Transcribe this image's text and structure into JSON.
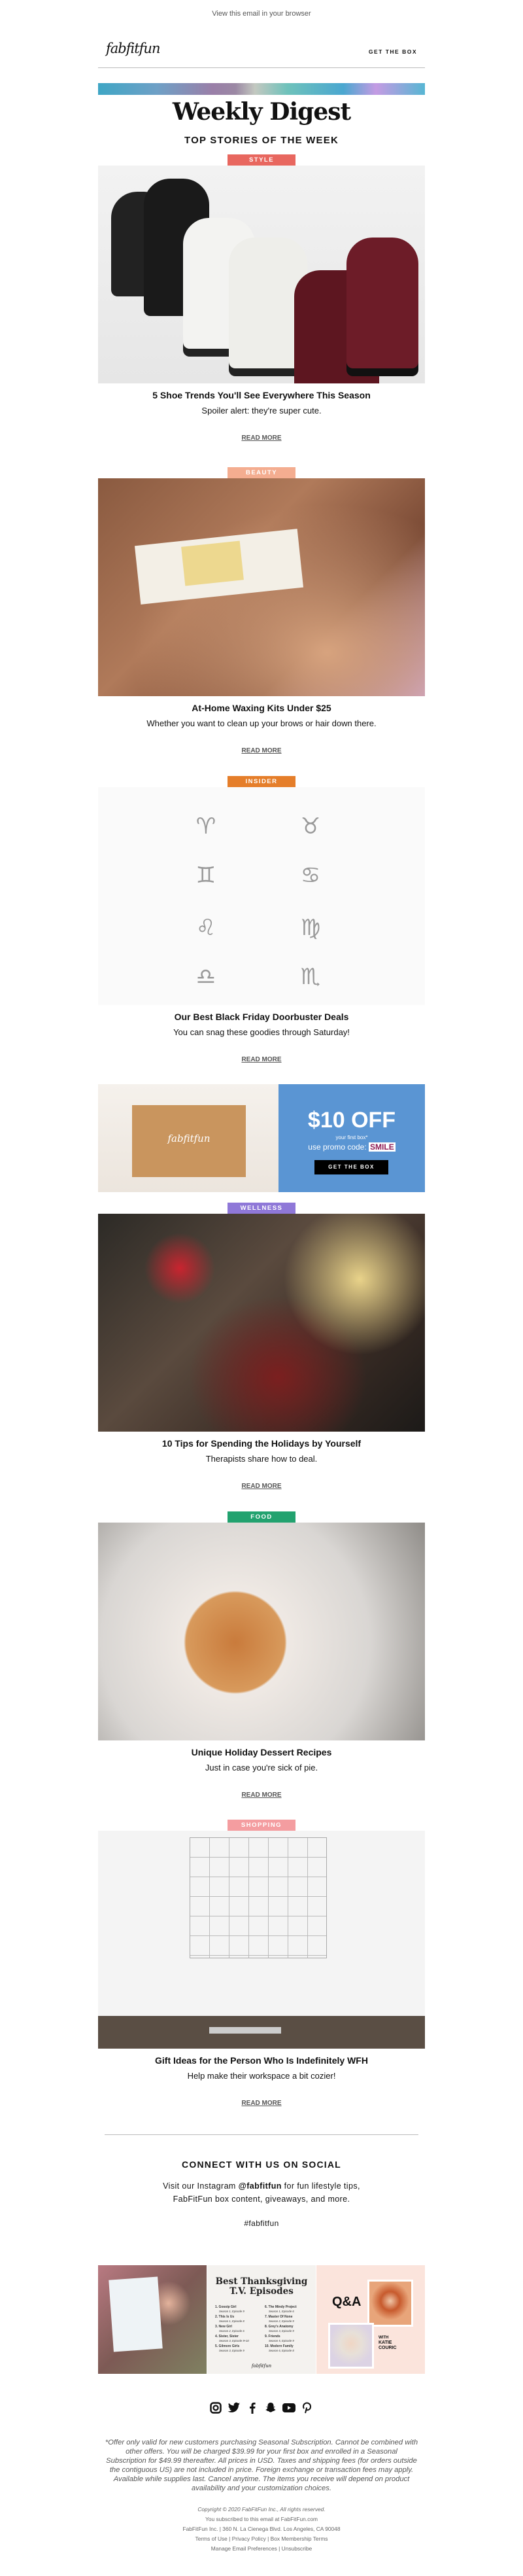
{
  "header": {
    "view_in_browser": "View this email in your browser",
    "logo": "fabfitfun",
    "get_the_box": "GET THE BOX"
  },
  "hero": {
    "title": "Weekly Digest",
    "subtitle": "TOP STORIES OF THE WEEK"
  },
  "articles": [
    {
      "tag": "STYLE",
      "tag_color": "#e8675f",
      "title": "5 Shoe Trends You'll See Everywhere This Season",
      "subtitle": "Spoiler alert: they're super cute.",
      "read_more": "READ MORE"
    },
    {
      "tag": "BEAUTY",
      "tag_color": "#f4ad90",
      "title": "At-Home Waxing Kits Under $25",
      "subtitle": "Whether you want to clean up your brows or hair down there.",
      "read_more": "READ MORE"
    },
    {
      "tag": "INSIDER",
      "tag_color": "#e57e2a",
      "title": "Our Best Black Friday Doorbuster Deals",
      "subtitle": "You can snag these goodies through Saturday!",
      "read_more": "READ MORE"
    },
    {
      "tag": "WELLNESS",
      "tag_color": "#8f78d8",
      "title": "10 Tips for Spending the Holidays by Yourself",
      "subtitle": "Therapists share how to deal.",
      "read_more": "READ MORE"
    },
    {
      "tag": "FOOD",
      "tag_color": "#22a26f",
      "title": "Unique Holiday Dessert Recipes",
      "subtitle": "Just in case you're sick of pie.",
      "read_more": "READ MORE"
    },
    {
      "tag": "SHOPPING",
      "tag_color": "#f49da0",
      "title": "Gift Ideas for the Person Who Is Indefinitely WFH",
      "subtitle": "Help make their workspace a bit cozier!",
      "read_more": "READ MORE"
    }
  ],
  "promo": {
    "box_logo": "fabfitfun",
    "headline": "$10 OFF",
    "subline": "your first box*",
    "code_prefix": "use promo code:",
    "code": "SMILE",
    "button": "GET THE BOX",
    "bg_color": "#5a95d3"
  },
  "social": {
    "heading": "CONNECT WITH US ON SOCIAL",
    "line1_pre": "Visit our Instagram ",
    "handle": "@fabfitfun",
    "line1_post": " for fun lifestyle tips,",
    "line2": "FabFitFun box content, giveaways, and more.",
    "hashtag": "#fabfitfun",
    "icons": [
      "instagram-icon",
      "twitter-icon",
      "facebook-icon",
      "snapchat-icon",
      "youtube-icon",
      "pinterest-icon"
    ]
  },
  "instagram_tiles": {
    "tile2": {
      "title": "Best Thanksgiving T.V. Episodes",
      "episodes_left": [
        "1. Gossip Girl",
        "Season 1, Episode 9",
        "2. This Is Us",
        "Season 1, Episode 8",
        "3. New Girl",
        "Season 2, Episode 6",
        "4. Sister, Sister",
        "Season 3, Episode 9+10",
        "5. Gilmore Girls",
        "Season 3, Episode 9"
      ],
      "episodes_right": [
        "6. The Mindy Project",
        "Season 1, Episode 6",
        "7. Master Of None",
        "Season 2, Episode 9",
        "8. Grey's Anatomy",
        "Season 3, Episode 9",
        "9. Friends",
        "Season 5, Episode 9",
        "10. Modern Family",
        "Season 6, Episode 8"
      ],
      "logo": "fabfitfun"
    },
    "tile3": {
      "qa": "Q&A",
      "with": "WITH",
      "name_first": "KATIE",
      "name_last": "COURIC"
    }
  },
  "footer": {
    "disclaimer": "*Offer only valid for new customers purchasing Seasonal Subscription. Cannot be combined with other offers. You will be charged $39.99 for your first box and enrolled in a Seasonal Subscription for $49.99 thereafter. All prices in USD. Taxes and shipping fees (for orders outside the contiguous US) are not included in price. Foreign exchange or transaction fees may apply. Available while supplies last. Cancel anytime. The items you receive will depend on product availability and your customization choices.",
    "copyright": "Copyright © 2020 FabFitFun Inc., All rights reserved.",
    "subscribed": "You subscribed to this email at FabFitFun.com",
    "address": "FabFitFun Inc. | 360 N. La Cienega Blvd. Los Angeles, CA 90048",
    "terms": "Terms of Use",
    "privacy": "Privacy Policy",
    "box_terms": "Box Membership Terms",
    "manage": "Manage Email Preferences",
    "unsubscribe": "Unsubscribe",
    "sep": " | "
  }
}
